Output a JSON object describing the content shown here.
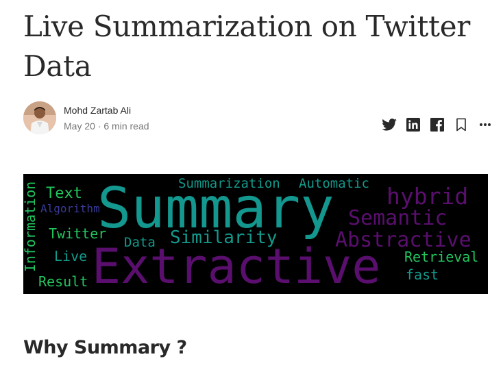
{
  "article": {
    "title": "Live Summarization on Twitter Data",
    "section_heading": "Why Summary ?"
  },
  "author": {
    "name": "Mohd Zartab Ali",
    "date": "May 20",
    "separator": "·",
    "read_time": "6 min read"
  },
  "share_icons": [
    "twitter-icon",
    "linkedin-icon",
    "facebook-icon",
    "bookmark-icon",
    "more-icon"
  ],
  "wordcloud": {
    "words": [
      {
        "text": "Summary",
        "color": "#13978f"
      },
      {
        "text": "Extractive",
        "color": "#5a0f6e"
      },
      {
        "text": "Summarization",
        "color": "#139a8c"
      },
      {
        "text": "Automatic",
        "color": "#139a8c"
      },
      {
        "text": "hybrid",
        "color": "#5a0f6e"
      },
      {
        "text": "Semantic",
        "color": "#5a0f6e"
      },
      {
        "text": "Abstractive",
        "color": "#5a0f6e"
      },
      {
        "text": "Similarity",
        "color": "#139a8c"
      },
      {
        "text": "Data",
        "color": "#139a8c"
      },
      {
        "text": "Text",
        "color": "#22c55e"
      },
      {
        "text": "Algorithm",
        "color": "#3a3a9a"
      },
      {
        "text": "Twitter",
        "color": "#22c55e"
      },
      {
        "text": "Live",
        "color": "#139a8c"
      },
      {
        "text": "Result",
        "color": "#22c55e"
      },
      {
        "text": "Information",
        "color": "#22c55e"
      },
      {
        "text": "Retrieval",
        "color": "#22c55e"
      },
      {
        "text": "fast",
        "color": "#139a8c"
      }
    ]
  }
}
